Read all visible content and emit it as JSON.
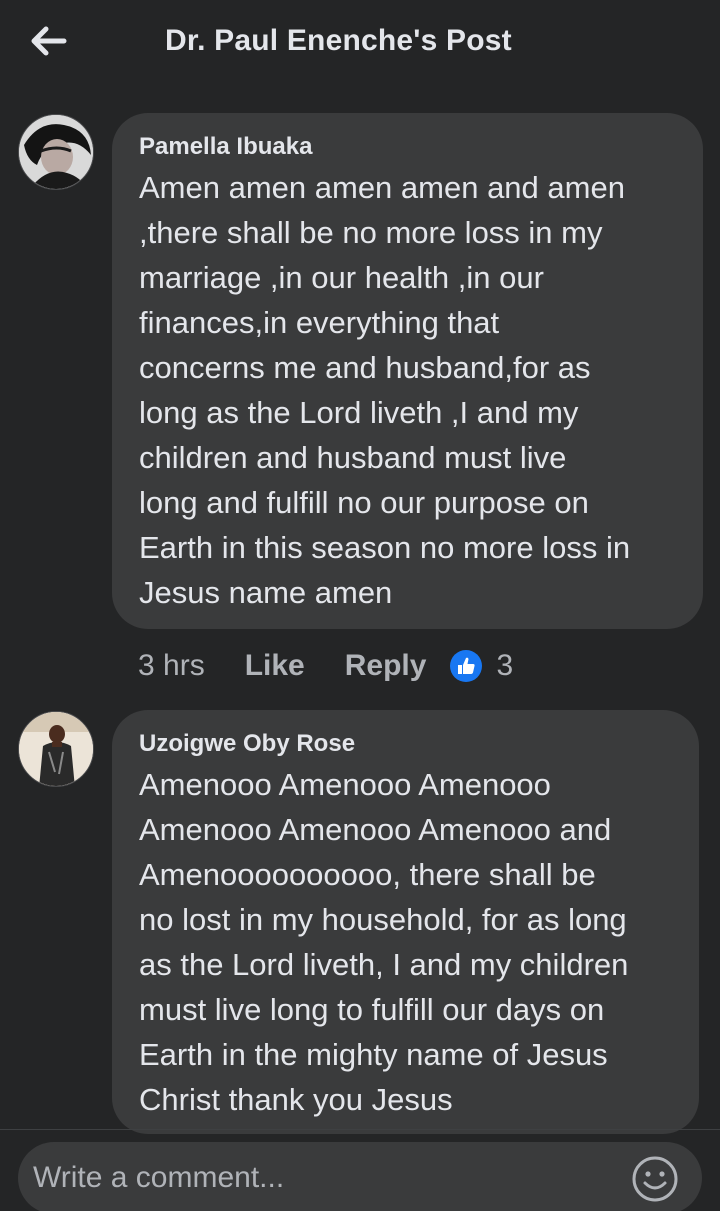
{
  "header": {
    "back_icon": "arrow-left-icon",
    "title": "Dr. Paul Enenche's Post"
  },
  "comments": [
    {
      "author": "Pamella Ibuaka",
      "text": "Amen amen amen amen and amen\n,there shall be no more loss in my\nmarriage ,in our health ,in our\nfinances,in everything that\nconcerns me and husband,for as\nlong as the Lord liveth ,I and my\nchildren and husband must live\nlong and fulfill no our purpose on\nEarth in this season no more loss in\nJesus name amen",
      "time": "3 hrs",
      "like_label": "Like",
      "reply_label": "Reply",
      "reaction_icon": "thumbs-up-icon",
      "reaction_count": "3"
    },
    {
      "author": "Uzoigwe Oby Rose",
      "text": "Amenooo Amenooo Amenooo\nAmenooo Amenooo Amenooo and\nAmenoooooooooo, there shall be\nno lost in my household, for as long\nas the Lord liveth, I and my children\nmust live long to fulfill our days on\nEarth in the mighty name of Jesus\nChrist thank you Jesus"
    }
  ],
  "composer": {
    "placeholder": "Write a comment...",
    "emoji_icon": "smiley-face-icon"
  },
  "colors": {
    "background": "#242526",
    "bubble": "#3a3b3c",
    "text_primary": "#e4e6eb",
    "text_secondary": "#b0b3b8",
    "like_blue": "#1877f2"
  }
}
